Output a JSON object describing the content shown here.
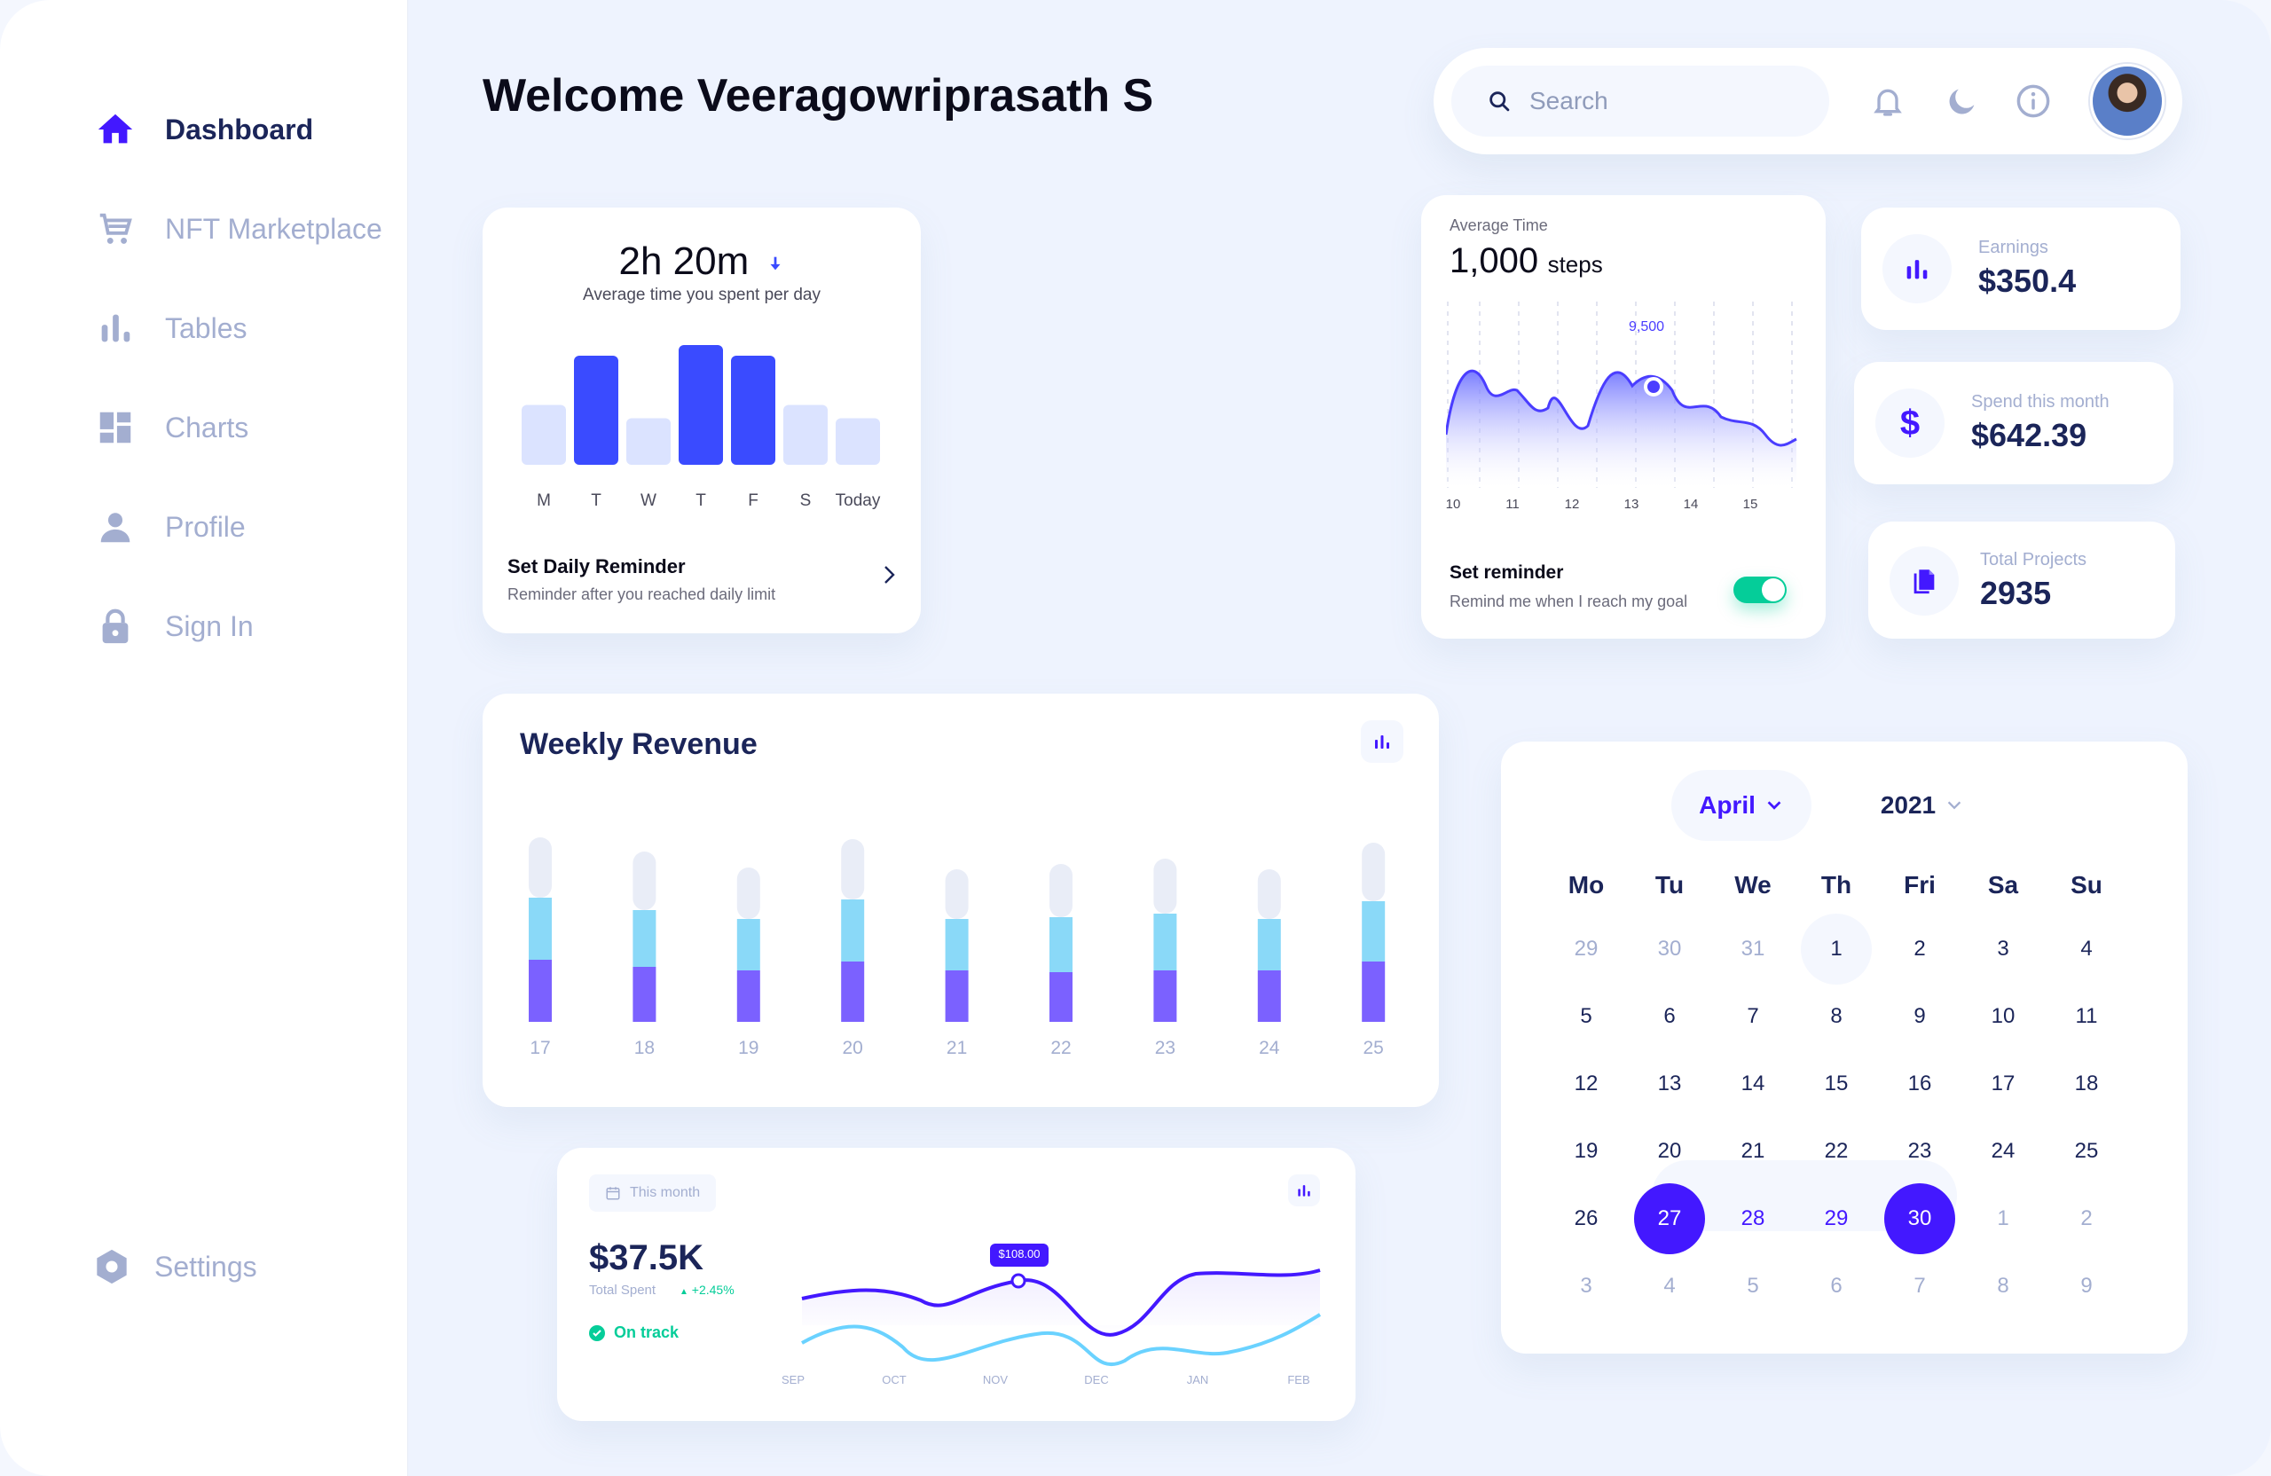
{
  "sidebar": {
    "items": [
      {
        "label": "Dashboard",
        "icon": "home-icon"
      },
      {
        "label": "NFT Marketplace",
        "icon": "cart-icon"
      },
      {
        "label": "Tables",
        "icon": "bar-chart-icon"
      },
      {
        "label": "Charts",
        "icon": "dashboard-grid-icon"
      },
      {
        "label": "Profile",
        "icon": "person-icon"
      },
      {
        "label": "Sign In",
        "icon": "lock-icon"
      }
    ],
    "settings_label": "Settings"
  },
  "header": {
    "welcome": "Welcome Veeragowriprasath S",
    "search_placeholder": "Search"
  },
  "time_card": {
    "value": "2h 20m",
    "subtitle": "Average time you spent per day",
    "days": [
      "M",
      "T",
      "W",
      "T",
      "F",
      "S",
      "Today"
    ],
    "values": [
      0.45,
      0.82,
      0.35,
      0.9,
      0.82,
      0.45,
      0.35
    ],
    "highlight": [
      false,
      true,
      false,
      true,
      true,
      false,
      false
    ],
    "reminder_title": "Set Daily Reminder",
    "reminder_sub": "Reminder after you reached daily limit"
  },
  "steps_card": {
    "label": "Average Time",
    "value": "1,000",
    "unit": "steps",
    "peak_label": "9,500",
    "x_labels": [
      "10",
      "11",
      "12",
      "13",
      "14",
      "15"
    ],
    "reminder_title": "Set reminder",
    "reminder_sub": "Remind me when I reach my goal",
    "toggle_on": true
  },
  "stats": [
    {
      "label": "Earnings",
      "value": "$350.4",
      "icon": "bar-chart-icon"
    },
    {
      "label": "Spend this month",
      "value": "$642.39",
      "icon": "dollar-icon"
    },
    {
      "label": "Total Projects",
      "value": "2935",
      "icon": "document-icon"
    }
  ],
  "weekly_revenue": {
    "title": "Weekly Revenue",
    "days": [
      "17",
      "18",
      "19",
      "20",
      "21",
      "22",
      "23",
      "24",
      "25"
    ]
  },
  "monthly": {
    "period_label": "This month",
    "total": "$37.5K",
    "total_label": "Total Spent",
    "change": "+2.45%",
    "status": "On track",
    "tooltip": "$108.00",
    "months": [
      "SEP",
      "OCT",
      "NOV",
      "DEC",
      "JAN",
      "FEB"
    ]
  },
  "calendar": {
    "month": "April",
    "year": "2021",
    "weekdays": [
      "Mo",
      "Tu",
      "We",
      "Th",
      "Fri",
      "Sa",
      "Su"
    ],
    "weeks": [
      [
        "29",
        "30",
        "31",
        "1",
        "2",
        "3",
        "4"
      ],
      [
        "5",
        "6",
        "7",
        "8",
        "9",
        "10",
        "11"
      ],
      [
        "12",
        "13",
        "14",
        "15",
        "16",
        "17",
        "18"
      ],
      [
        "19",
        "20",
        "21",
        "22",
        "23",
        "24",
        "25"
      ],
      [
        "26",
        "27",
        "28",
        "29",
        "30",
        "1",
        "2"
      ],
      [
        "3",
        "4",
        "5",
        "6",
        "7",
        "8",
        "9"
      ]
    ]
  },
  "colors": {
    "brand": "#4318ff",
    "bar_blue": "#3a4bff",
    "bar_light": "#dbe3ff",
    "revenue_purple": "#7b61ff",
    "revenue_cyan": "#8ad9f8",
    "revenue_track": "#e9edf7",
    "line_cyan": "#6ad2ff",
    "success": "#05cd99"
  }
}
